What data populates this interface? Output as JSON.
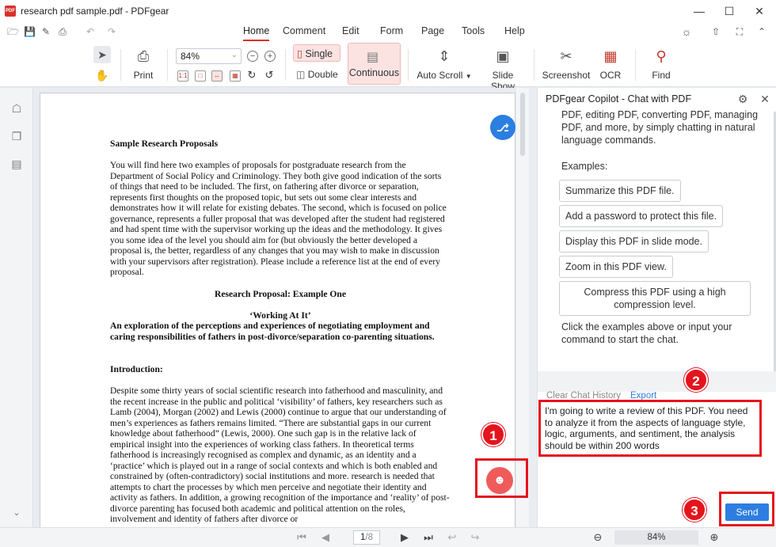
{
  "window": {
    "title": "research pdf sample.pdf - PDFgear",
    "logo_text": "PDF"
  },
  "menu": {
    "tabs": [
      "Home",
      "Comment",
      "Edit",
      "Form",
      "Page",
      "Tools",
      "Help"
    ],
    "active": "Home"
  },
  "ribbon": {
    "print": "Print",
    "zoom_value": "84%",
    "single": "Single",
    "double": "Double",
    "continuous": "Continuous",
    "auto_scroll": "Auto Scroll",
    "slide_show": "Slide Show",
    "screenshot": "Screenshot",
    "ocr": "OCR",
    "find": "Find"
  },
  "document": {
    "heading1": "Sample Research Proposals",
    "para1": "You will find here two examples of proposals for postgraduate research from the Department of Social Policy and Criminology.  They both give good indication of the sorts of things that need to be included.  The first, on fathering after divorce or separation, represents first thoughts on the proposed topic, but sets out some clear interests and demonstrates how it will relate for existing debates.  The second, which is focused on police governance, represents a fuller proposal that was developed after the student had registered and had spent time with the supervisor working up the ideas and the methodology. It gives you some idea of the level you should aim for (but obviously the better developed a proposal is, the better, regardless of any changes that you may wish to make in discussion with your supervisors after registration). Please include a reference list at the end of every proposal.",
    "heading2": "Research Proposal: Example One",
    "heading3": "‘Working At It’",
    "heading4": "An exploration of the perceptions and experiences of negotiating employment and caring responsibilities of fathers in post-divorce/separation co-parenting situations.",
    "heading5": "Introduction:",
    "para2": "Despite some thirty years of social scientific research into fatherhood and masculinity, and the recent increase in the public and political ‘visibility’ of fathers, key researchers such as Lamb (2004), Morgan (2002) and Lewis (2000) continue to argue that our understanding of men’s experiences as fathers remains limited.  “There are substantial gaps in our current knowledge about fatherhood” (Lewis, 2000). One such gap is in the relative lack of empirical insight into the experiences of working class fathers. In theoretical terms fatherhood is increasingly recognised as complex and dynamic, as an identity and a ‘practice’ which is played out in a range of social contexts and which is both enabled and constrained by (often-contradictory) social institutions and more. research is needed that attempts to chart the processes by which men perceive and negotiate their identity and activity as fathers. In addition, a growing recognition of the importance and ‘reality’ of post-divorce parenting has focused both academic and political attention on the roles, involvement and identity of fathers after divorce or"
  },
  "panel": {
    "title": "PDFgear Copilot - Chat with PDF",
    "intro": "PDF, editing PDF, converting PDF, managing PDF, and more, by simply chatting in natural language commands.",
    "examples_label": "Examples:",
    "examples": [
      "Summarize this PDF file.",
      "Add a password to protect this file.",
      "Display this PDF in slide mode.",
      "Zoom in this PDF view.",
      "Compress this PDF using a high compression level."
    ],
    "hint": "Click the examples above or input your command to start the chat.",
    "clear_history": "Clear Chat History",
    "export": "Export",
    "input_text": "I'm going to write a review of this PDF. You need to analyze it from the aspects of language style, logic, arguments, and sentiment, the analysis should be within 200 words",
    "send": "Send"
  },
  "annotations": [
    "1",
    "2",
    "3"
  ],
  "status": {
    "page": "1",
    "page_total": "/8",
    "zoom": "84%"
  },
  "colors": {
    "accent_red": "#d9302c",
    "annotation_red": "#e4141c",
    "send_blue": "#2d7ee0",
    "translate_blue": "#2b7fe0"
  }
}
